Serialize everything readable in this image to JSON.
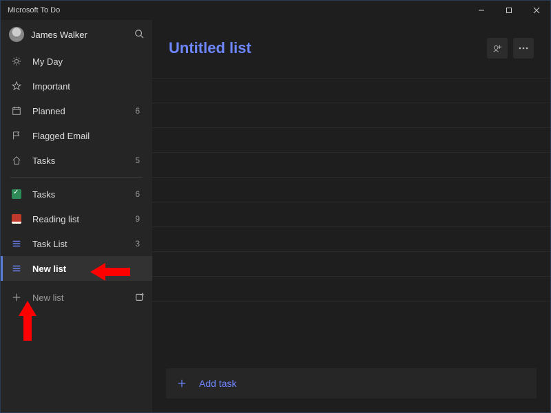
{
  "title": "Microsoft To Do",
  "user": {
    "name": "James Walker"
  },
  "smart_lists": [
    {
      "id": "myday",
      "label": "My Day",
      "count": "",
      "icon": "sun"
    },
    {
      "id": "important",
      "label": "Important",
      "count": "",
      "icon": "star"
    },
    {
      "id": "planned",
      "label": "Planned",
      "count": "6",
      "icon": "calendar"
    },
    {
      "id": "flagged",
      "label": "Flagged Email",
      "count": "",
      "icon": "flag"
    },
    {
      "id": "tasks",
      "label": "Tasks",
      "count": "5",
      "icon": "home"
    }
  ],
  "custom_lists": [
    {
      "id": "tasks2",
      "label": "Tasks",
      "count": "6",
      "icon": "greenbox"
    },
    {
      "id": "reading",
      "label": "Reading list",
      "count": "9",
      "icon": "redbox"
    },
    {
      "id": "tasklist",
      "label": "Task List",
      "count": "3",
      "icon": "list"
    },
    {
      "id": "newlist",
      "label": "New list",
      "count": "",
      "icon": "list",
      "selected": true
    }
  ],
  "new_list_label": "New list",
  "main": {
    "list_title": "Untitled list",
    "add_task_label": "Add task"
  },
  "colors": {
    "accent": "#6e86ff",
    "arrow": "#ff0000"
  }
}
